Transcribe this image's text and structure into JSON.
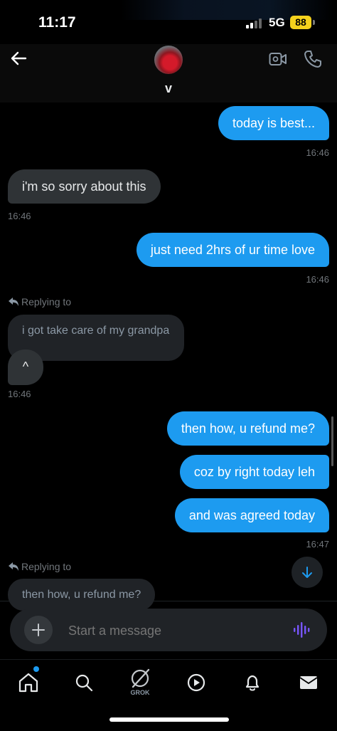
{
  "status_bar": {
    "time": "11:17",
    "network": "5G",
    "battery": "88"
  },
  "header": {
    "contact_name": "v",
    "icons": [
      "back-arrow-icon",
      "video-call-icon",
      "phone-call-icon"
    ]
  },
  "messages": [
    {
      "text": "today is best...",
      "direction": "outgoing"
    },
    {
      "time": "16:46"
    },
    {
      "text": "i'm so sorry about this",
      "direction": "incoming"
    },
    {
      "time": "16:46"
    },
    {
      "text": "just need 2hrs of ur time love",
      "direction": "outgoing"
    },
    {
      "time": "16:46"
    },
    {
      "replying_label": "Replying to",
      "quoted": "i got take care of my grandpa",
      "text": "^",
      "direction": "incoming"
    },
    {
      "time": "16:46"
    },
    {
      "text": "then how, u refund me?",
      "direction": "outgoing"
    },
    {
      "text": "coz by right today leh",
      "direction": "outgoing"
    },
    {
      "text": "and was agreed today",
      "direction": "outgoing"
    },
    {
      "time": "16:47"
    },
    {
      "replying_label": "Replying to",
      "quoted": "then how, u refund me?",
      "direction": "incoming"
    }
  ],
  "composer": {
    "placeholder": "Start a message"
  },
  "bottom_nav": {
    "grok_label": "GROK",
    "items": [
      "home-icon",
      "search-icon",
      "grok-icon",
      "play-icon",
      "bell-icon",
      "mail-icon"
    ]
  },
  "colors": {
    "outgoing_bubble": "#1d9bf0",
    "incoming_bubble": "#2f3336",
    "quoted_bubble": "#202327",
    "background": "#000000",
    "accent": "#1d9bf0",
    "battery": "#f5d21d",
    "voice_icon": "#7856ff"
  }
}
